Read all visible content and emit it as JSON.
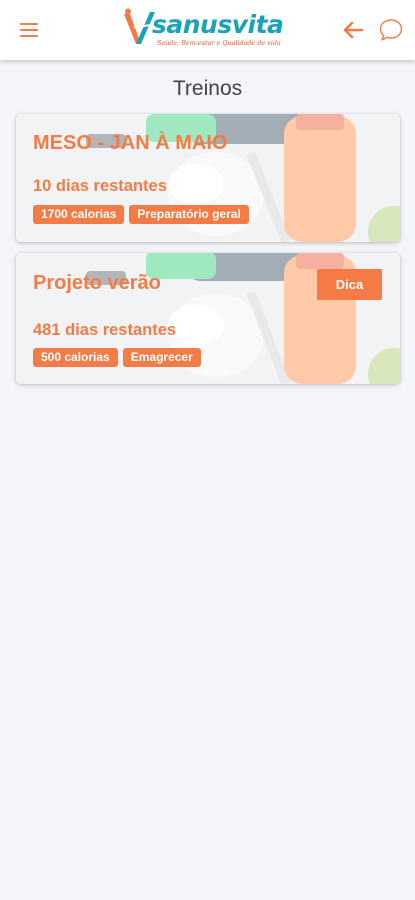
{
  "header": {
    "logo_text": "sanusvita",
    "logo_tagline": "Saúde, Bem-estar e Qualidade de vida",
    "menu_icon": "hamburger-menu-icon",
    "back_icon": "arrow-left-icon",
    "chat_icon": "chat-bubble-icon"
  },
  "page": {
    "title": "Treinos"
  },
  "colors": {
    "accent": "#f47b45",
    "brand_teal": "#1aa3b8",
    "background": "#f4f5f9",
    "title_text": "#444444"
  },
  "workouts": [
    {
      "title": "MESO - JAN À MAIO",
      "remaining": "10 dias restantes",
      "tags": [
        "1700 calorias",
        "Preparatório geral"
      ]
    },
    {
      "title": "Projeto verão",
      "remaining": "481 dias restantes",
      "tags": [
        "500 calorias",
        "Emagrecer"
      ],
      "tip_label": "Dica"
    }
  ]
}
